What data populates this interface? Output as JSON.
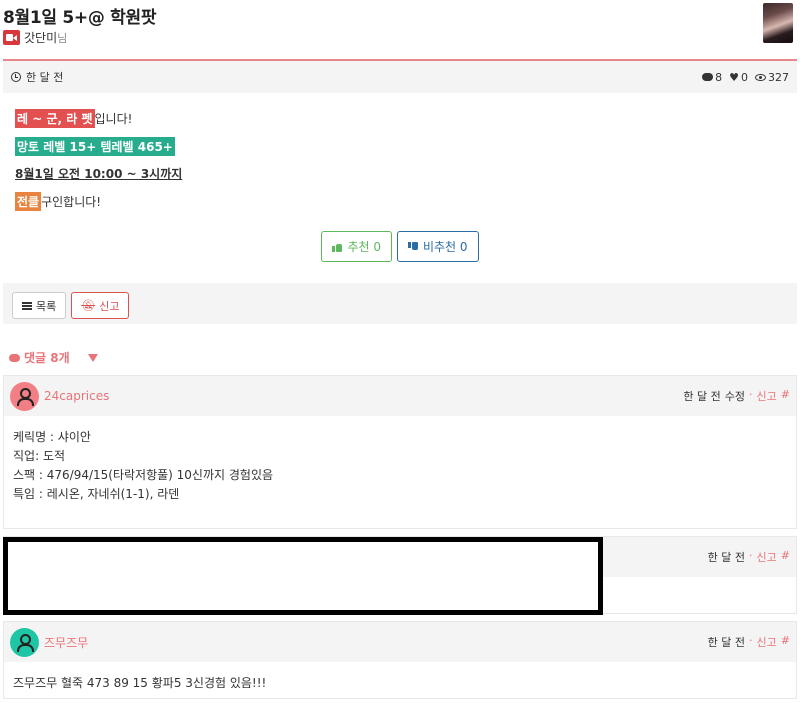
{
  "post": {
    "title": "8월1일 5+@ 학원팟",
    "author": "갓단미",
    "author_suffix": "님",
    "time": "한 달 전",
    "stats": {
      "comments": "8",
      "likes": "0",
      "views": "327"
    },
    "lines": {
      "l1_highlight": "레 ~ 군, 라 펫",
      "l1_rest": "입니다!",
      "l2_highlight": "망토 레벨 15+ 템레벨 465+",
      "l3": "8월1일 오전 10:00 ~ 3시까지",
      "l4_highlight": "전클",
      "l4_rest": " 구인합니다!"
    },
    "vote_up_label": "추천 0",
    "vote_down_label": "비추천 0",
    "list_label": "목록",
    "report_label": "신고"
  },
  "comments_header": {
    "label": "댓글 8개"
  },
  "comments": [
    {
      "user": "24caprices",
      "avatar_color": "#f27f86",
      "time": "한 달 전",
      "edit": "수정",
      "sep": "·",
      "report": "신고",
      "hash": "#",
      "lines": [
        "케릭명 : 샤이안",
        "직업: 도적",
        "스팩 : 476/94/15(타락저항풀) 10신까지 경험있음",
        "특임 : 레시온, 자네쉬(1-1), 라덴"
      ]
    },
    {
      "user": "",
      "time": "한 달 전",
      "sep": "·",
      "report": "신고",
      "hash": "#"
    },
    {
      "user": "즈무즈무",
      "avatar_color": "#1fc6a6",
      "time": "한 달 전",
      "sep": "·",
      "report": "신고",
      "hash": "#",
      "lines": [
        "즈무즈무 혈죽 473 89 15 황파5  3신경험 있음!!!"
      ]
    }
  ],
  "colors": {
    "accent": "#e87479",
    "highlight_red": "#e2504f",
    "highlight_green": "#27ad8e",
    "highlight_orange": "#e8843f",
    "vote_up": "#5cb85c",
    "vote_down": "#2b6da3"
  }
}
